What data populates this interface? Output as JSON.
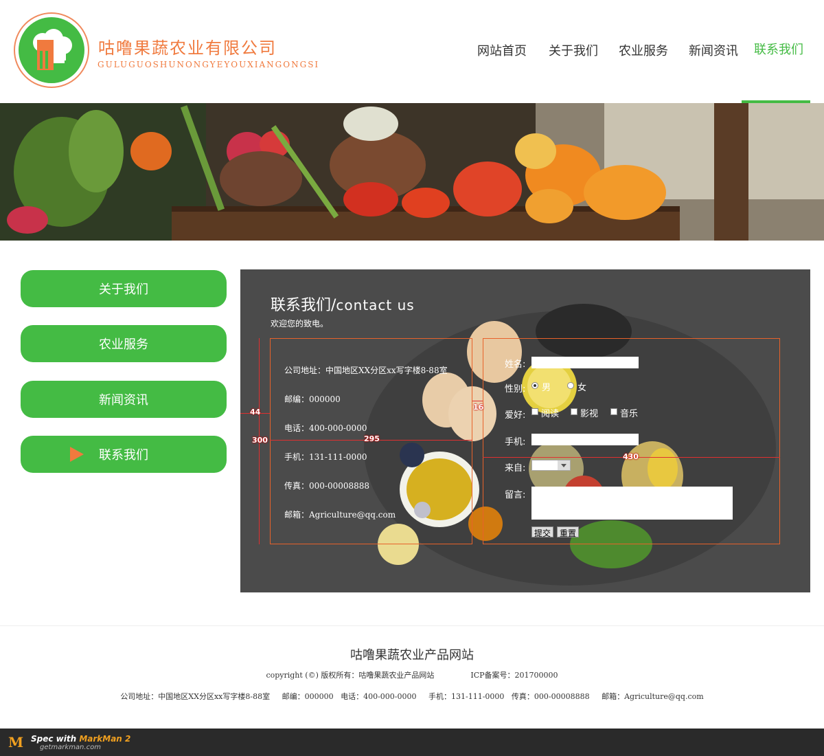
{
  "header": {
    "company_name": "咕噜果蔬农业有限公司",
    "company_pinyin": "GULUGUOSHUNONGYEYOUXIANGONGSI",
    "nav": [
      {
        "label": "网站首页",
        "active": false
      },
      {
        "label": "关于我们",
        "active": false
      },
      {
        "label": "农业服务",
        "active": false
      },
      {
        "label": "新闻资讯",
        "active": false
      },
      {
        "label": "联系我们",
        "active": true
      }
    ]
  },
  "sidebar": {
    "items": [
      {
        "label": "关于我们",
        "active": false
      },
      {
        "label": "农业服务",
        "active": false
      },
      {
        "label": "新闻资讯",
        "active": false
      },
      {
        "label": "联系我们",
        "active": true
      }
    ]
  },
  "contact": {
    "title_cn": "联系我们/",
    "title_en": "contact us",
    "subtitle": "欢迎您的致电。",
    "info": [
      "公司地址：中国地区XX分区xx写字楼8-88室",
      "邮编：000000",
      "电话：400-000-0000",
      "手机：131-111-0000",
      "传真：000-00008888",
      "邮箱：Agriculture@qq.com"
    ],
    "form": {
      "name_label": "姓名:",
      "gender_label": "性别:",
      "gender_male": "男",
      "gender_female": "女",
      "hobby_label": "爱好:",
      "hobby_read": "阅读",
      "hobby_movie": "影视",
      "hobby_music": "音乐",
      "phone_label": "手机:",
      "from_label": "来自:",
      "message_label": "留言:",
      "submit_label": "提交",
      "reset_label": "重置"
    }
  },
  "annotations": {
    "m44": "44",
    "m300": "300",
    "m295": "295",
    "m16": "16",
    "m430": "430"
  },
  "footer": {
    "title": "咕噜果蔬农业产品网站",
    "copyright": "copyright (©) 版权所有：咕噜果蔬农业产品网站",
    "icp": "ICP备案号：201700000",
    "address": "公司地址：中国地区XX分区xx写字楼8-88室",
    "postcode": "邮编：000000",
    "phone": "电话：400-000-0000",
    "mobile": "手机：131-111-0000",
    "fax": "传真：000-00008888",
    "email": "邮箱：Agriculture@qq.com"
  },
  "markman": {
    "spec_prefix": "Spec with ",
    "brand": "MarkMan 2",
    "url": "getmarkman.com"
  },
  "colors": {
    "accent_green": "#44bb44",
    "accent_orange": "#f07a3e",
    "spec_red": "#e03030"
  }
}
